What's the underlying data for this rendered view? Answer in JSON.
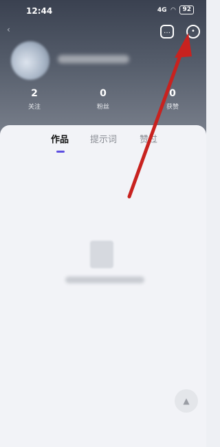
{
  "status_bar": {
    "time": "12:44",
    "signal": "4G",
    "battery": "92"
  },
  "header": {
    "stats": [
      {
        "value": "2",
        "label": "关注"
      },
      {
        "value": "0",
        "label": "粉丝"
      },
      {
        "value": "0",
        "label": "获赞"
      }
    ]
  },
  "tabs": [
    {
      "label": "作品",
      "active": true
    },
    {
      "label": "提示词",
      "active": false
    },
    {
      "label": "赞过",
      "active": false
    }
  ],
  "icons": {
    "message": "message-icon",
    "settings": "settings-icon",
    "back": "back-icon",
    "scroll_top": "scroll-top-icon"
  },
  "colors": {
    "annotation_arrow": "#c8221f",
    "tab_indicator": "#5b4ce0"
  }
}
